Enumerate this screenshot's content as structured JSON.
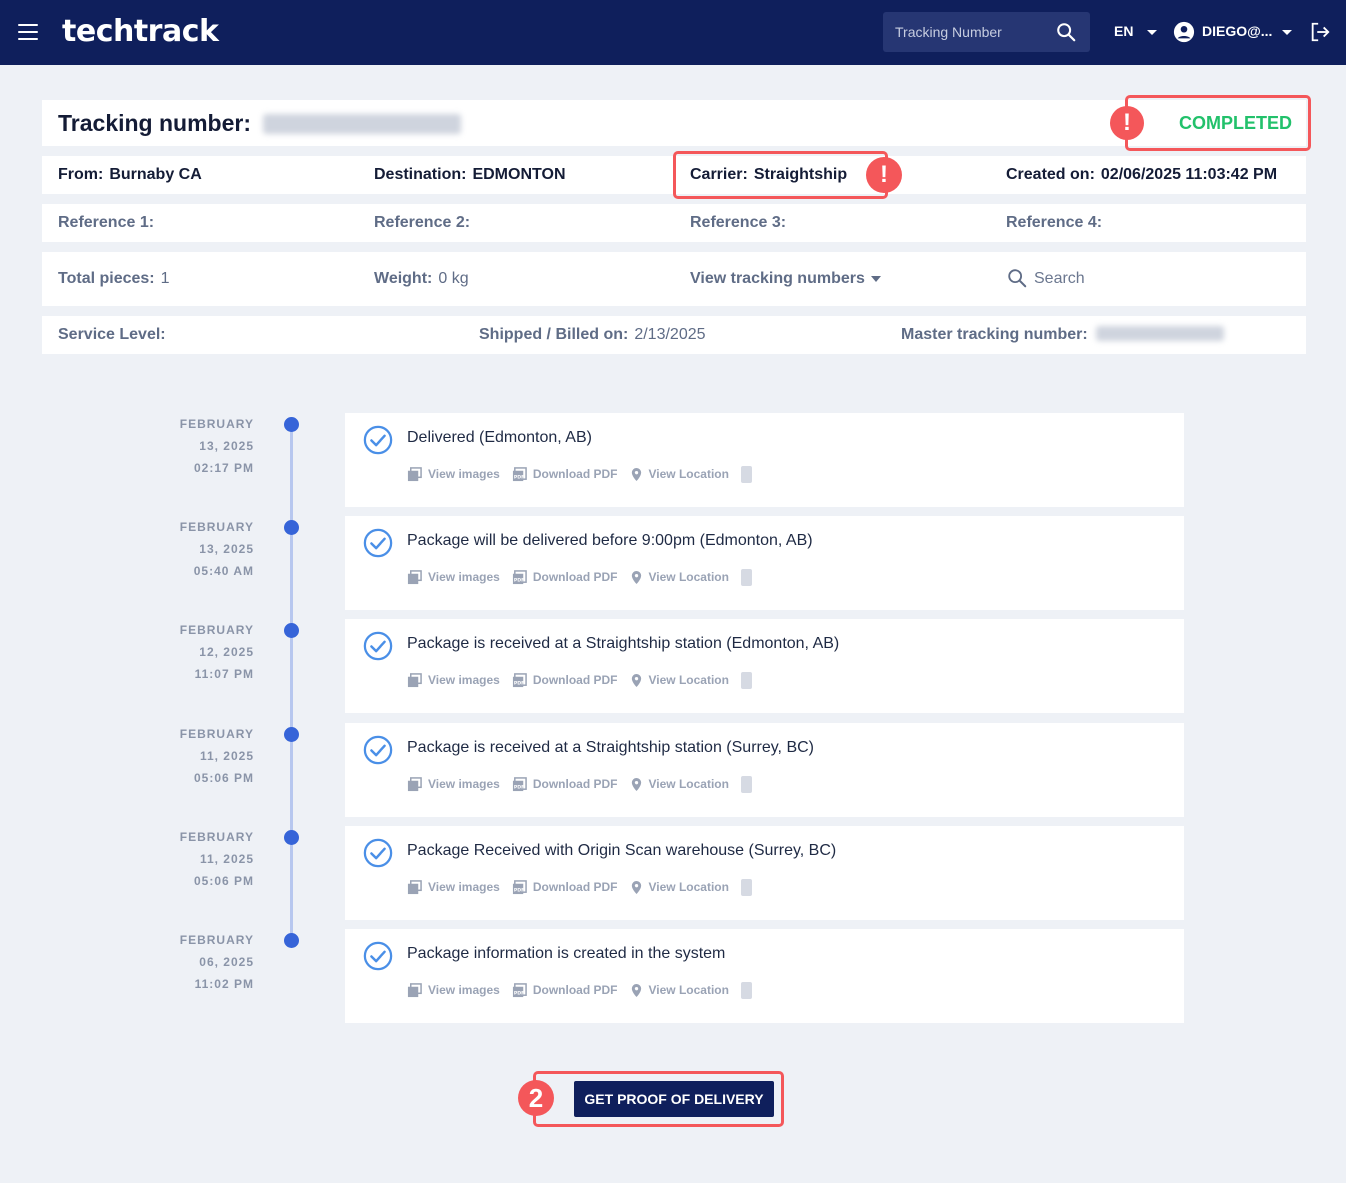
{
  "header": {
    "brand": "techtrack",
    "search_placeholder": "Tracking Number",
    "language": "EN",
    "user": "DIEGO@..."
  },
  "shipment": {
    "tracking_label": "Tracking number:",
    "status": "COMPLETED",
    "from_label": "From:",
    "from_value": "Burnaby CA",
    "destination_label": "Destination:",
    "destination_value": "EDMONTON",
    "carrier_label": "Carrier:",
    "carrier_value": "Straightship",
    "created_label": "Created on:",
    "created_value": "02/06/2025 11:03:42 PM",
    "reference_1_label": "Reference 1:",
    "reference_2_label": "Reference 2:",
    "reference_3_label": "Reference 3:",
    "reference_4_label": "Reference 4:",
    "total_pieces_label": "Total pieces:",
    "total_pieces_value": "1",
    "weight_label": "Weight:",
    "weight_value": "0 kg",
    "view_tracking_numbers": "View tracking numbers",
    "search_placeholder": "Search",
    "service_level_label": "Service Level:",
    "shipped_label": "Shipped / Billed on:",
    "shipped_value": "2/13/2025",
    "master_label": "Master tracking number:"
  },
  "callouts": {
    "status_badge": "!",
    "carrier_badge": "!",
    "pod_badge": "2"
  },
  "events": [
    {
      "month": "FEBRUARY",
      "day": "13, 2025",
      "time": "02:17 PM",
      "title": "Delivered (Edmonton, AB)"
    },
    {
      "month": "FEBRUARY",
      "day": "13, 2025",
      "time": "05:40 AM",
      "title": "Package will be delivered before 9:00pm (Edmonton, AB)"
    },
    {
      "month": "FEBRUARY",
      "day": "12, 2025",
      "time": "11:07 PM",
      "title": "Package is received at a Straightship station (Edmonton, AB)"
    },
    {
      "month": "FEBRUARY",
      "day": "11, 2025",
      "time": "05:06 PM",
      "title": "Package is received at a Straightship station (Surrey, BC)"
    },
    {
      "month": "FEBRUARY",
      "day": "11, 2025",
      "time": "05:06 PM",
      "title": "Package Received with Origin Scan warehouse (Surrey, BC)"
    },
    {
      "month": "FEBRUARY",
      "day": "06, 2025",
      "time": "11:02 PM",
      "title": "Package information is created in the system"
    }
  ],
  "actions": {
    "view_images": "View images",
    "download_pdf": "Download PDF",
    "view_location": "View Location"
  },
  "proof_button": "GET PROOF OF DELIVERY",
  "colors": {
    "navbar": "#0f1f5c",
    "status_green": "#22c16b",
    "timeline_dot": "#3664d8",
    "callout_red": "#f4575a"
  },
  "icons": [
    "menu-icon",
    "search-icon",
    "user-circle-icon",
    "logout-icon",
    "check-circle-icon",
    "image-icon",
    "pdf-icon",
    "location-pin-icon",
    "alert-icon"
  ]
}
